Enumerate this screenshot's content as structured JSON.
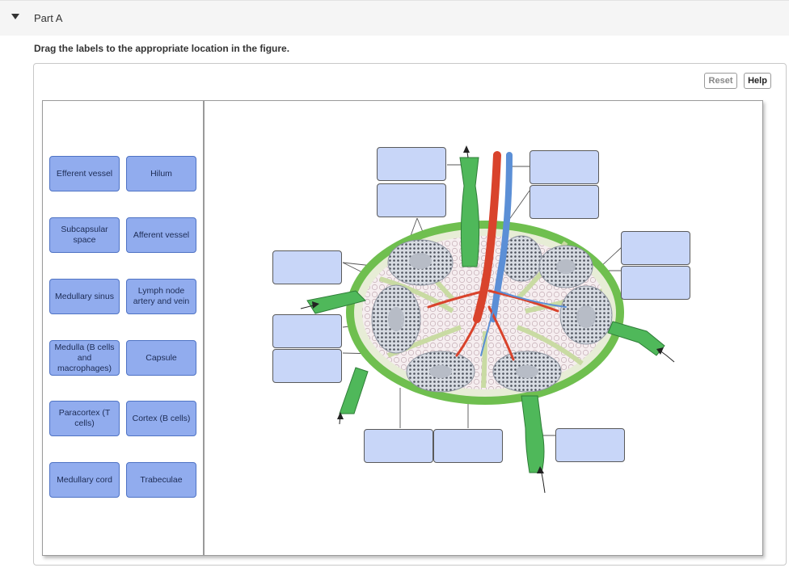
{
  "part": {
    "title": "Part A"
  },
  "instructions": "Drag the labels to the appropriate location in the figure.",
  "toolbar": {
    "reset_label": "Reset",
    "help_label": "Help"
  },
  "labels": [
    "Efferent vessel",
    "Hilum",
    "Subcapsular space",
    "Afferent vessel",
    "Medullary sinus",
    "Lymph node artery and vein",
    "Medulla (B cells and macrophages)",
    "Capsule",
    "Paracortex (T cells)",
    "Cortex (B cells)",
    "Medullary cord",
    "Trabeculae"
  ],
  "drop_target_count": 12,
  "colors": {
    "label_fill": "#91acee",
    "drop_fill": "#c8d6f8",
    "artery": "#d9432c",
    "vein": "#5b8fd6",
    "lymph_vessel": "#4fb85a"
  }
}
